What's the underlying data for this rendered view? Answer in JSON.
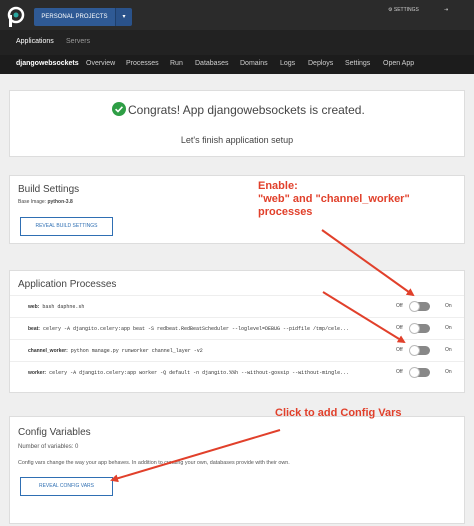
{
  "topbar": {
    "project_label": "PERSONAL PROJECTS",
    "caret": "▾",
    "settings_label": "⚙ SETTINGS",
    "logout_label": "⇥"
  },
  "topnav": {
    "applications": "Applications",
    "servers": "Servers"
  },
  "appnav": {
    "items": [
      "djangowebsockets",
      "Overview",
      "Processes",
      "Run",
      "Databases",
      "Domains",
      "Logs",
      "Deploys",
      "Settings",
      "Open App"
    ]
  },
  "congrats": {
    "title": "Congrats! App djangowebsockets is created.",
    "subtitle": "Let's finish application setup"
  },
  "build": {
    "title": "Build Settings",
    "base_image_label": "Base Image:",
    "base_image_value": "python-3.8",
    "button": "REVEAL BUILD SETTINGS"
  },
  "processes": {
    "title": "Application Processes",
    "off_label": "Off",
    "on_label": "On",
    "rows": [
      {
        "name": "web:",
        "command": "bash daphne.sh"
      },
      {
        "name": "beat:",
        "command": "celery -A djangito.celery:app beat -S redbeat.RedBeatScheduler --loglevel=DEBUG --pidfile /tmp/cele..."
      },
      {
        "name": "channel_worker:",
        "command": "python manage.py runworker channel_layer -v2"
      },
      {
        "name": "worker:",
        "command": "celery -A djangito.celery:app worker -Q default -n djangito.%%h --without-gossip --without-mingle..."
      }
    ]
  },
  "config": {
    "title": "Config Variables",
    "count_text": "Number of variables: 0",
    "description": "Config vars change the way your app behaves. In addition to creating your own, databases provide with their own.",
    "button": "REVEAL CONFIG VARS"
  },
  "annotations": {
    "enable_lines": [
      "Enable:",
      "\"web\" and \"channel_worker\"",
      "processes"
    ],
    "config_text": "Click to add Config Vars"
  },
  "colors": {
    "brand": "#2f5a95",
    "accent": "#2f6fb3",
    "annotation": "#e1402b",
    "success": "#2e9e45"
  }
}
